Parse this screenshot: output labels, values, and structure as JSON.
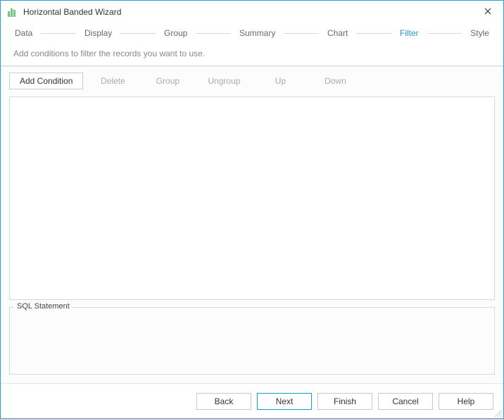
{
  "window": {
    "title": "Horizontal Banded Wizard"
  },
  "steps": {
    "items": [
      {
        "label": "Data",
        "active": false
      },
      {
        "label": "Display",
        "active": false
      },
      {
        "label": "Group",
        "active": false
      },
      {
        "label": "Summary",
        "active": false
      },
      {
        "label": "Chart",
        "active": false
      },
      {
        "label": "Filter",
        "active": true
      },
      {
        "label": "Style",
        "active": false
      }
    ]
  },
  "subtitle": "Add conditions to filter the records you want to use.",
  "toolbar": {
    "add_condition": "Add Condition",
    "delete": "Delete",
    "group": "Group",
    "ungroup": "Ungroup",
    "up": "Up",
    "down": "Down"
  },
  "sql": {
    "legend": "SQL Statement"
  },
  "footer": {
    "back": "Back",
    "next": "Next",
    "finish": "Finish",
    "cancel": "Cancel",
    "help": "Help"
  }
}
